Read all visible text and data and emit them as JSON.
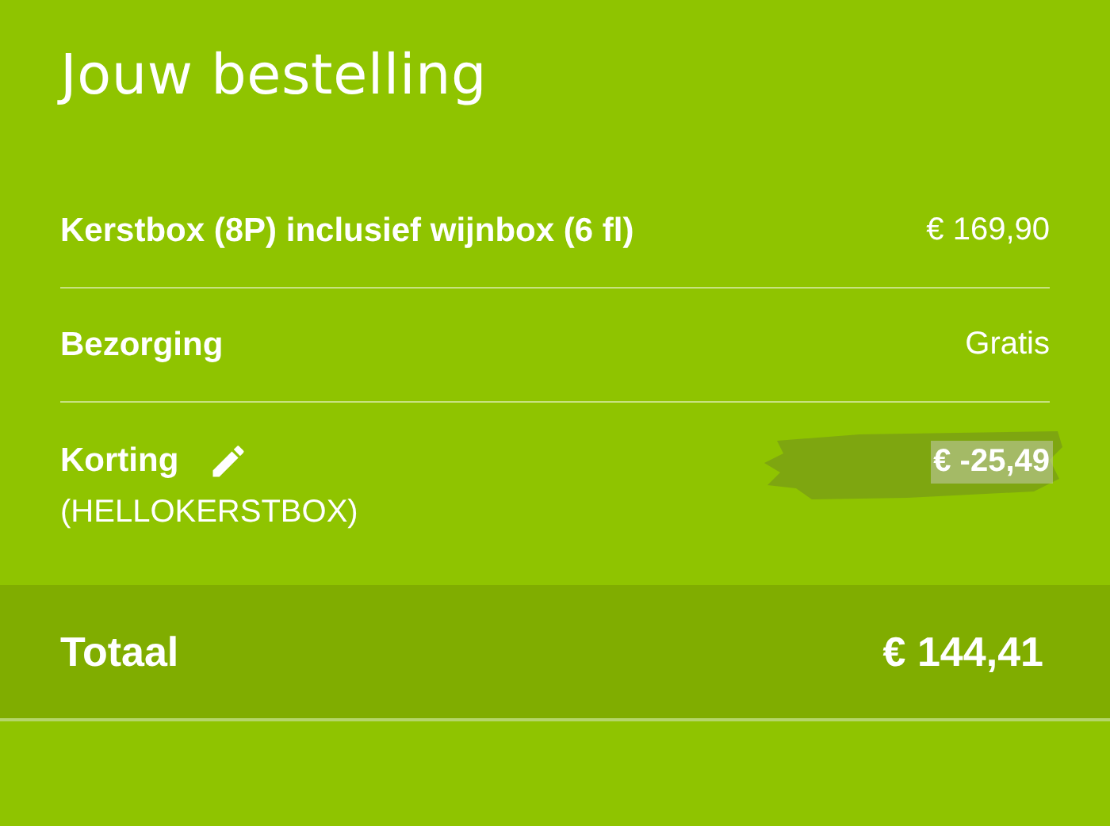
{
  "title": "Jouw bestelling",
  "lines": [
    {
      "label": "Kerstbox (8P) inclusief wijnbox (6 fl)",
      "amount": "€ 169,90",
      "editable": false,
      "highlighted": false
    },
    {
      "label": "Bezorging",
      "amount": "Gratis",
      "editable": false,
      "highlighted": false
    },
    {
      "label": "Korting",
      "code": "(HELLOKERSTBOX)",
      "amount": "€ -25,49",
      "editable": true,
      "highlighted": true
    }
  ],
  "total": {
    "label": "Totaal",
    "amount": "€ 144,41"
  }
}
